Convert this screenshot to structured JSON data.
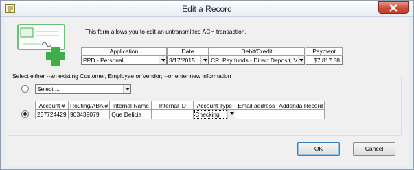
{
  "window": {
    "title": "Edit a Record"
  },
  "intro_text": "This form allows you to edit an untransmitted ACH transaction.",
  "transaction": {
    "headers": {
      "application": "Application",
      "date": "Date",
      "debit_credit": "Debit/Credit",
      "payment": "Payment"
    },
    "application": "PPD - Personal",
    "date": "3/17/2015",
    "debit_credit": "CR: Pay funds - Direct Deposit, Venc",
    "payment": "$7,817.58"
  },
  "selection": {
    "label": "Select either --an existing Customer, Employee or Vendor;  --or enter new information",
    "existing_select": "Select ...",
    "columns": [
      "Account #",
      "Routing/ABA #",
      "Internal Name",
      "Internal ID",
      "Account Type",
      "Email address",
      "Addenda Record"
    ],
    "row": {
      "account": "237724429",
      "routing": "903439079",
      "internal_name": "Que Delicia",
      "internal_id": "",
      "account_type": "Checking",
      "email": "",
      "addenda": ""
    }
  },
  "buttons": {
    "ok": "OK",
    "cancel": "Cancel"
  },
  "colors": {
    "accent_green": "#3fae4a",
    "close_red": "#c74b3b"
  }
}
